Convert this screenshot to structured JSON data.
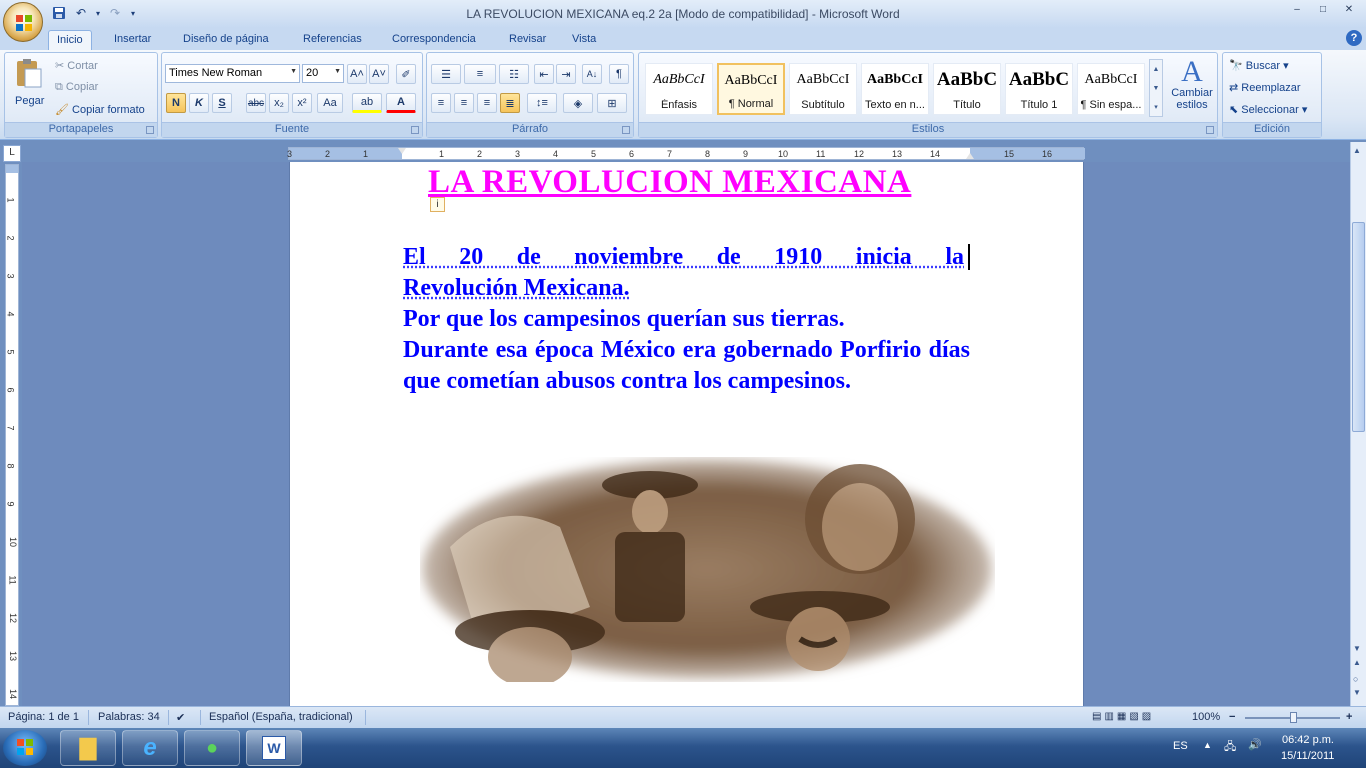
{
  "window": {
    "title": "LA   REVOLUCION MEXICANA eq.2 2a [Modo de compatibilidad] - Microsoft Word",
    "minimize": "–",
    "maximize": "□",
    "close": "✕"
  },
  "qat": {
    "save": "💾",
    "undo": "↶",
    "redo": "↷",
    "customize": "▾"
  },
  "tabs": [
    {
      "label": "Inicio",
      "active": true
    },
    {
      "label": "Insertar"
    },
    {
      "label": "Diseño de página"
    },
    {
      "label": "Referencias"
    },
    {
      "label": "Correspondencia"
    },
    {
      "label": "Revisar"
    },
    {
      "label": "Vista"
    }
  ],
  "help": "?",
  "ribbon": {
    "clipboard": {
      "label": "Portapapeles",
      "paste": "Pegar",
      "cut": "Cortar",
      "copy": "Copiar",
      "format_painter": "Copiar formato"
    },
    "font": {
      "label": "Fuente",
      "family": "Times New Roman",
      "size": "20",
      "grow": "A˄",
      "shrink": "A˅",
      "clear": "✐",
      "bold": "N",
      "italic": "K",
      "underline": "S",
      "strike": "abc",
      "subscript": "x₂",
      "superscript": "x²",
      "case": "Aa",
      "highlight": "ab",
      "color": "A"
    },
    "paragraph": {
      "label": "Párrafo",
      "pilcrow": "¶",
      "sort": "A↓"
    },
    "styles": {
      "label": "Estilos",
      "change": "Cambiar estilos",
      "items": [
        {
          "preview": "AaBbCcI",
          "name": "Énfasis"
        },
        {
          "preview": "AaBbCcI",
          "name": "¶ Normal",
          "selected": true
        },
        {
          "preview": "AaBbCcI",
          "name": "Subtítulo"
        },
        {
          "preview": "AaBbCcI",
          "name": "Texto en n..."
        },
        {
          "preview": "AaBbC",
          "name": "Título"
        },
        {
          "preview": "AaBbC",
          "name": "Título 1"
        },
        {
          "preview": "AaBbCcI",
          "name": "¶ Sin espa..."
        }
      ]
    },
    "editing": {
      "label": "Edición",
      "find": "Buscar",
      "replace": "Reemplazar",
      "select": "Seleccionar"
    }
  },
  "ruler": {
    "corner": "L",
    "h_ticks": [
      "3",
      "2",
      "1",
      "1",
      "2",
      "3",
      "4",
      "5",
      "6",
      "7",
      "8",
      "9",
      "10",
      "11",
      "12",
      "13",
      "14",
      "15",
      "16",
      "17"
    ],
    "v_ticks": [
      "1",
      "2",
      "3",
      "4",
      "5",
      "6",
      "7",
      "8",
      "9",
      "10",
      "11",
      "12",
      "13",
      "14"
    ]
  },
  "document": {
    "title": "LA   REVOLUCION MEXICANA",
    "paragraphs": [
      "El 20 de noviembre de 1910  inicia    la",
      "Revolución  Mexicana.",
      "Por que los campesinos  querían sus tierras.",
      "Durante esa época México era gobernado Porfirio días que cometían abusos  contra los campesinos."
    ],
    "info_marker": "i"
  },
  "status": {
    "page": "Página: 1 de 1",
    "words": "Palabras: 34",
    "language": "Español (España, tradicional)",
    "zoom": "100%",
    "zoom_out": "−",
    "zoom_in": "+"
  },
  "taskbar": {
    "lang": "ES",
    "time": "06:42 p.m.",
    "date": "15/11/2011"
  }
}
